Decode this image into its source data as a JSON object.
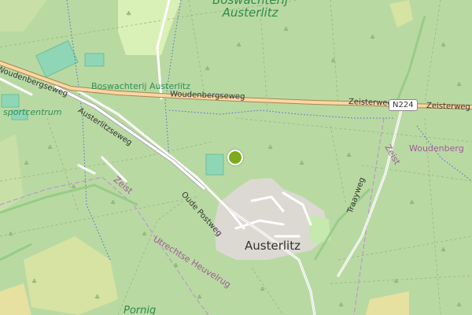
{
  "map": {
    "forest_label": "Boswachterij\nAusterlitz",
    "forest_label_south": "Pornig",
    "poi_boswachterij": "Boswachterij Austerlitz",
    "poi_sportcentrum": "sportcentrum",
    "roads": {
      "woudenbergseweg_west": "Woudenbergseweg",
      "woudenbergseweg_mid": "Woudenbergseweg",
      "zeisterweg_1": "Zeisterweg",
      "zeisterweg_2": "Zeisterweg",
      "austerlitzseweg": "Austerlitzseweg",
      "oude_postweg": "Oude Postweg",
      "traayweg": "Traayweg",
      "utrechtse_heuvelrug": "Utrechtse Heuvelrug"
    },
    "route_shield": "N224",
    "town": "Austerlitz",
    "admin": {
      "zeist_1": "Zeist",
      "zeist_2": "Zeist",
      "woudenberg": "Woudenberg"
    },
    "marker_color": "#7cab1d"
  }
}
